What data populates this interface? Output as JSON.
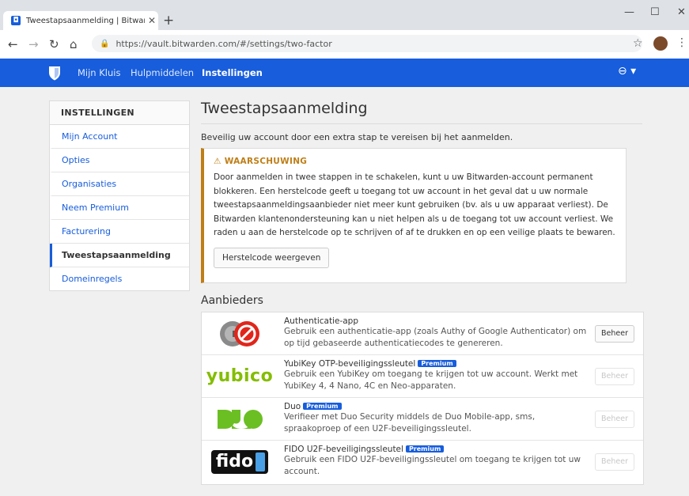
{
  "browser": {
    "tab_title": "Tweestapsaanmelding | Bitwarden",
    "tab_favicon_glyph": "◘",
    "new_tab_glyph": "+",
    "url": "https://vault.bitwarden.com/#/settings/two-factor",
    "icons": [
      "back-icon",
      "forward-icon",
      "reload-icon",
      "home-icon",
      "lock-icon",
      "star-icon",
      "profile-icon",
      "kebab-icon",
      "minimize-icon",
      "maximize-icon",
      "close-icon"
    ]
  },
  "nav": {
    "items": [
      {
        "label": "Mijn Kluis"
      },
      {
        "label": "Hulpmiddelen"
      },
      {
        "label": "Instellingen"
      }
    ],
    "brand_color": "#175ddc"
  },
  "sidebar": {
    "heading": "INSTELLINGEN",
    "items": [
      {
        "label": "Mijn Account"
      },
      {
        "label": "Opties"
      },
      {
        "label": "Organisaties"
      },
      {
        "label": "Neem Premium"
      },
      {
        "label": "Facturering"
      },
      {
        "label": "Tweestapsaanmelding"
      },
      {
        "label": "Domeinregels"
      }
    ],
    "active_index": 5
  },
  "main": {
    "title": "Tweestapsaanmelding",
    "intro": "Beveilig uw account door een extra stap te vereisen bij het aanmelden.",
    "warning": {
      "icon": "⚠",
      "title": "WAARSCHUWING",
      "body": "Door aanmelden in twee stappen in te schakelen, kunt u uw Bitwarden-account permanent blokkeren. Een herstelcode geeft u toegang tot uw account in het geval dat u uw normale tweestapsaanmeldingsaanbieder niet meer kunt gebruiken (bv. als u uw apparaat verliest). De Bitwarden klantenondersteuning kan u niet helpen als u de toegang tot uw account verliest. We raden u aan de herstelcode op te schrijven of af te drukken en op een veilige plaats te bewaren.",
      "button": "Herstelcode weergeven",
      "color": "#bf7e16"
    },
    "providers_title": "Aanbieders",
    "providers": [
      {
        "name": "Authenticatie-app",
        "premium": "",
        "desc": "Gebruik een authenticatie-app (zoals Authy of Google Authenticator) om op tijd gebaseerde authenticatiecodes te genereren.",
        "button": "Beheer",
        "logo": "authenticator-logo"
      },
      {
        "name": "YubiKey OTP-beveiligingssleutel",
        "premium": "Premium",
        "desc": "Gebruik een YubiKey om toegang te krijgen tot uw account. Werkt met YubiKey 4, 4 Nano, 4C en Neo-apparaten.",
        "button": "Beheer",
        "logo": "yubico-logo",
        "logo_text": "yubico"
      },
      {
        "name": "Duo",
        "premium": "Premium",
        "desc": "Verifieer met Duo Security middels de Duo Mobile-app, sms, spraakoproep of een U2F-beveiligingssleutel.",
        "button": "Beheer",
        "logo": "duo-logo"
      },
      {
        "name": "FIDO U2F-beveiligingssleutel",
        "premium": "Premium",
        "desc": "Gebruik een FIDO U2F-beveiligingssleutel om toegang te krijgen tot uw account.",
        "button": "Beheer",
        "logo": "fido-logo",
        "logo_text": "fido"
      }
    ]
  }
}
